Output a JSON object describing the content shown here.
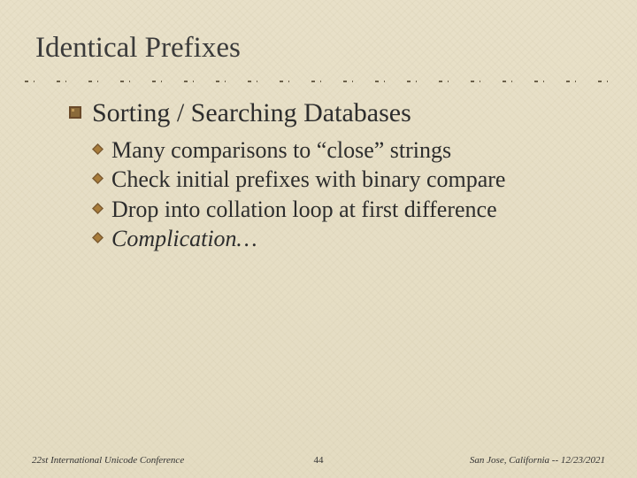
{
  "title": "Identical Prefixes",
  "bullets": {
    "main": "Sorting / Searching Databases",
    "subs": [
      {
        "text": "Many comparisons to “close” strings",
        "italic": false
      },
      {
        "text": "Check initial prefixes with binary compare",
        "italic": false
      },
      {
        "text": "Drop into collation loop at first difference",
        "italic": false
      },
      {
        "text": "Complication…",
        "italic": true
      }
    ]
  },
  "footer": {
    "left": "22st International Unicode Conference",
    "center": "44",
    "right": "San Jose, California -- 12/23/2021"
  },
  "colors": {
    "bulletDark": "#6a4a2a",
    "bulletLight": "#b88c4a"
  }
}
